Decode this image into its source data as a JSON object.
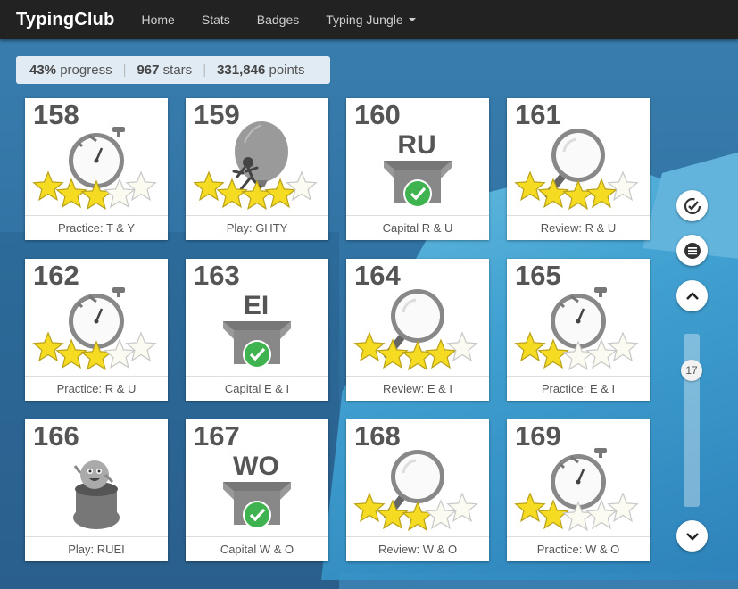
{
  "navbar": {
    "brand": "TypingClub",
    "links": [
      "Home",
      "Stats",
      "Badges",
      "Typing Jungle"
    ]
  },
  "progress": {
    "percent": "43%",
    "percent_label": "progress",
    "stars": "967",
    "stars_label": "stars",
    "points": "331,846",
    "points_label": "points"
  },
  "lessons": [
    {
      "num": "158",
      "label": "Practice: T & Y",
      "kind": "timer",
      "stars": 3
    },
    {
      "num": "159",
      "label": "Play: GHTY",
      "kind": "game-balloon",
      "stars": 4
    },
    {
      "num": "160",
      "label": "Capital R & U",
      "kind": "box",
      "box_text": "RU",
      "stars": 0
    },
    {
      "num": "161",
      "label": "Review: R & U",
      "kind": "magnifier",
      "stars": 4
    },
    {
      "num": "162",
      "label": "Practice: R & U",
      "kind": "timer",
      "stars": 3
    },
    {
      "num": "163",
      "label": "Capital E & I",
      "kind": "box",
      "box_text": "EI",
      "stars": 0
    },
    {
      "num": "164",
      "label": "Review: E & I",
      "kind": "magnifier",
      "stars": 4
    },
    {
      "num": "165",
      "label": "Practice: E & I",
      "kind": "timer",
      "stars": 2
    },
    {
      "num": "166",
      "label": "Play: RUEI",
      "kind": "game-hat",
      "stars": 0
    },
    {
      "num": "167",
      "label": "Capital W & O",
      "kind": "box",
      "box_text": "WO",
      "stars": 0
    },
    {
      "num": "168",
      "label": "Review: W & O",
      "kind": "magnifier",
      "stars": 3
    },
    {
      "num": "169",
      "label": "Practice: W & O",
      "kind": "timer",
      "stars": 2
    }
  ],
  "sidebar": {
    "scroll_value": "17"
  }
}
